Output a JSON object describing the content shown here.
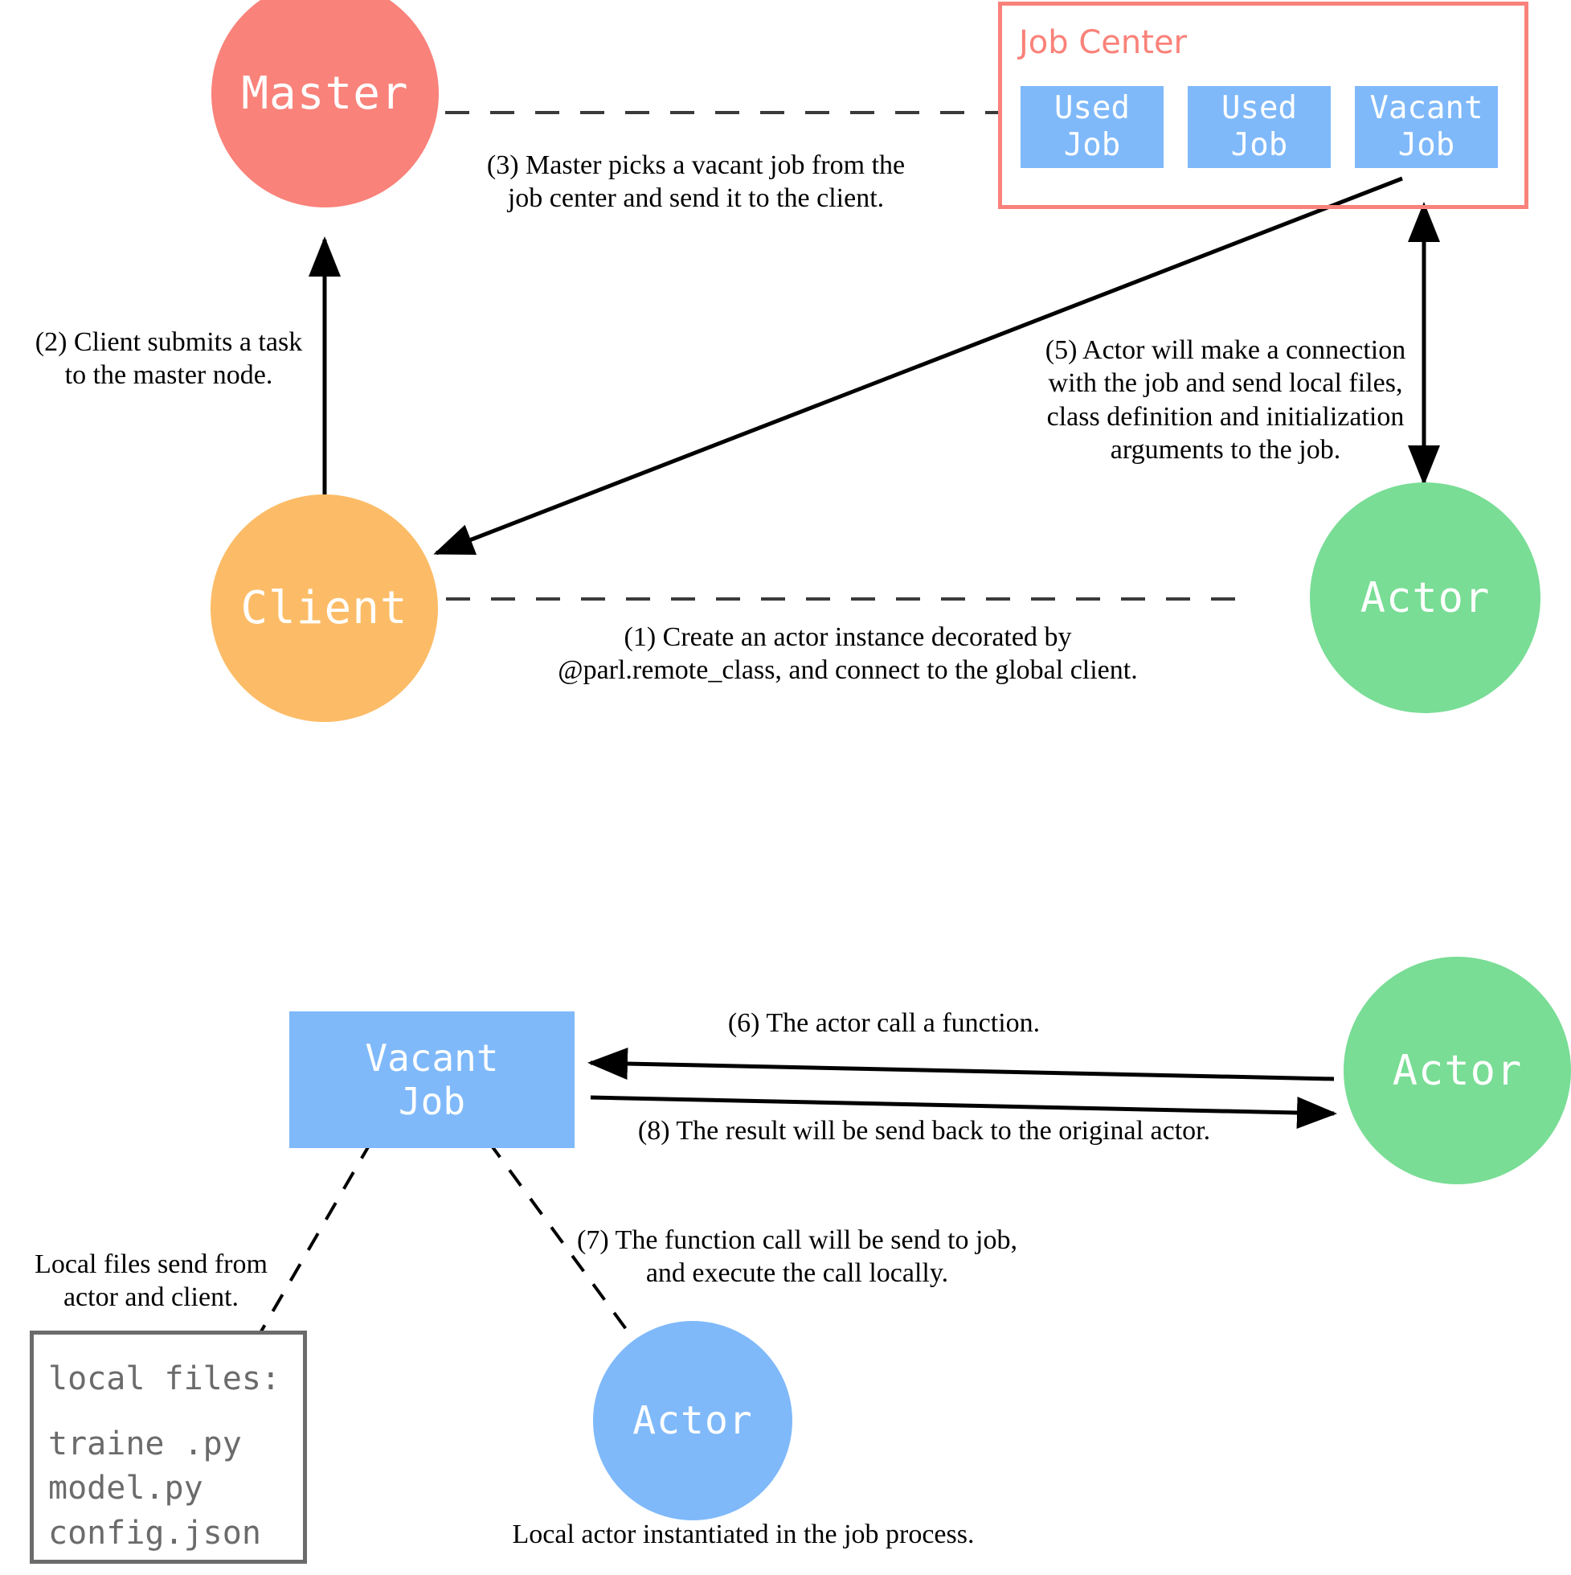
{
  "diagram": {
    "title": "PARL distributed actor/job workflow",
    "colors": {
      "master": "#F9827A",
      "client": "#FCBC67",
      "actor_green": "#79DD95",
      "actor_blue": "#7FB9FA",
      "job_blue": "#7FB9FA",
      "job_center_border": "#F9827A",
      "job_center_title": "#F9827A",
      "files_panel_border": "#6b6b6b",
      "files_text": "#6b6b6b",
      "arrow": "#000000"
    },
    "nodes": {
      "master": "Master",
      "client": "Client",
      "actor_top": "Actor",
      "actor_bottom": "Actor",
      "actor_local": "Actor"
    },
    "job_center": {
      "title": "Job Center",
      "jobs": [
        {
          "line1": "Used",
          "line2": "Job",
          "state": "used"
        },
        {
          "line1": "Used",
          "line2": "Job",
          "state": "used"
        },
        {
          "line1": "Vacant",
          "line2": "Job",
          "state": "vacant"
        }
      ]
    },
    "vacant_job_bottom": {
      "line1": "Vacant",
      "line2": "Job"
    },
    "annotations": {
      "step1": "(1) Create an actor instance decorated by\n@parl.remote_class, and connect to the global client.",
      "step2": "(2) Client submits a task\nto the master node.",
      "step3": "(3) Master picks a vacant job from the\njob center and send it to the client.",
      "step5": "(5) Actor will make a connection\nwith the job and send local files,\nclass definition and initialization\narguments to the job.",
      "step6": "(6) The actor call a function.",
      "step7": "(7) The function call will be send to job,\nand execute the call locally.",
      "step8": "(8) The result will be send back to the original actor.",
      "local_files_note": "Local files send from\nactor and client.",
      "local_actor_note": "Local actor instantiated in the job process."
    },
    "files_panel": {
      "heading": "local files:",
      "files": [
        "traine .py",
        "model.py",
        "config.json"
      ]
    }
  }
}
